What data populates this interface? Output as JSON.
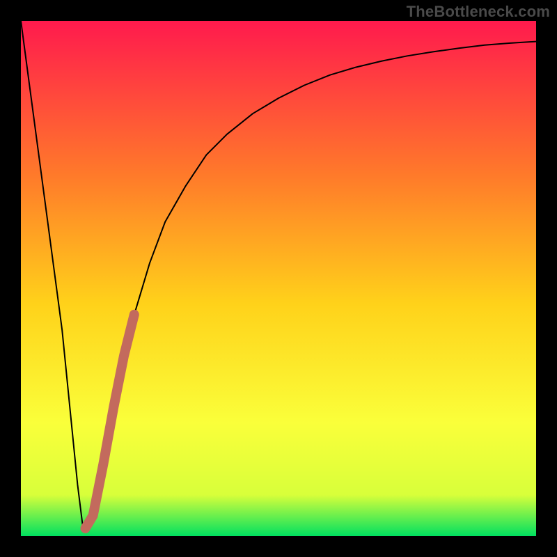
{
  "watermark": "TheBottleneck.com",
  "colors": {
    "frame": "#000000",
    "gradient_top": "#ff1a4d",
    "gradient_mid1": "#ff7a2a",
    "gradient_mid2": "#ffd21a",
    "gradient_mid3": "#faff3a",
    "gradient_low": "#d8ff3a",
    "gradient_bottom": "#00e060",
    "curve": "#000000",
    "highlight": "#c36a5d"
  },
  "chart_data": {
    "type": "line",
    "title": "",
    "xlabel": "",
    "ylabel": "",
    "xlim": [
      0,
      100
    ],
    "ylim": [
      0,
      100
    ],
    "series": [
      {
        "name": "bottleneck-curve",
        "x": [
          0,
          2,
          4,
          6,
          8,
          10,
          11,
          12,
          13,
          14,
          16,
          18,
          20,
          22,
          25,
          28,
          32,
          36,
          40,
          45,
          50,
          55,
          60,
          65,
          70,
          75,
          80,
          85,
          90,
          95,
          100
        ],
        "y": [
          100,
          85,
          70,
          55,
          40,
          20,
          10,
          2,
          1,
          4,
          14,
          25,
          35,
          43,
          53,
          61,
          68,
          74,
          78,
          82,
          85,
          87.5,
          89.5,
          91,
          92.2,
          93.2,
          94,
          94.7,
          95.3,
          95.7,
          96
        ]
      }
    ],
    "highlight_segment": {
      "name": "selected-range",
      "x": [
        12.5,
        14,
        16,
        18,
        20,
        22
      ],
      "y": [
        1.5,
        4,
        14,
        25,
        35,
        43
      ]
    }
  }
}
